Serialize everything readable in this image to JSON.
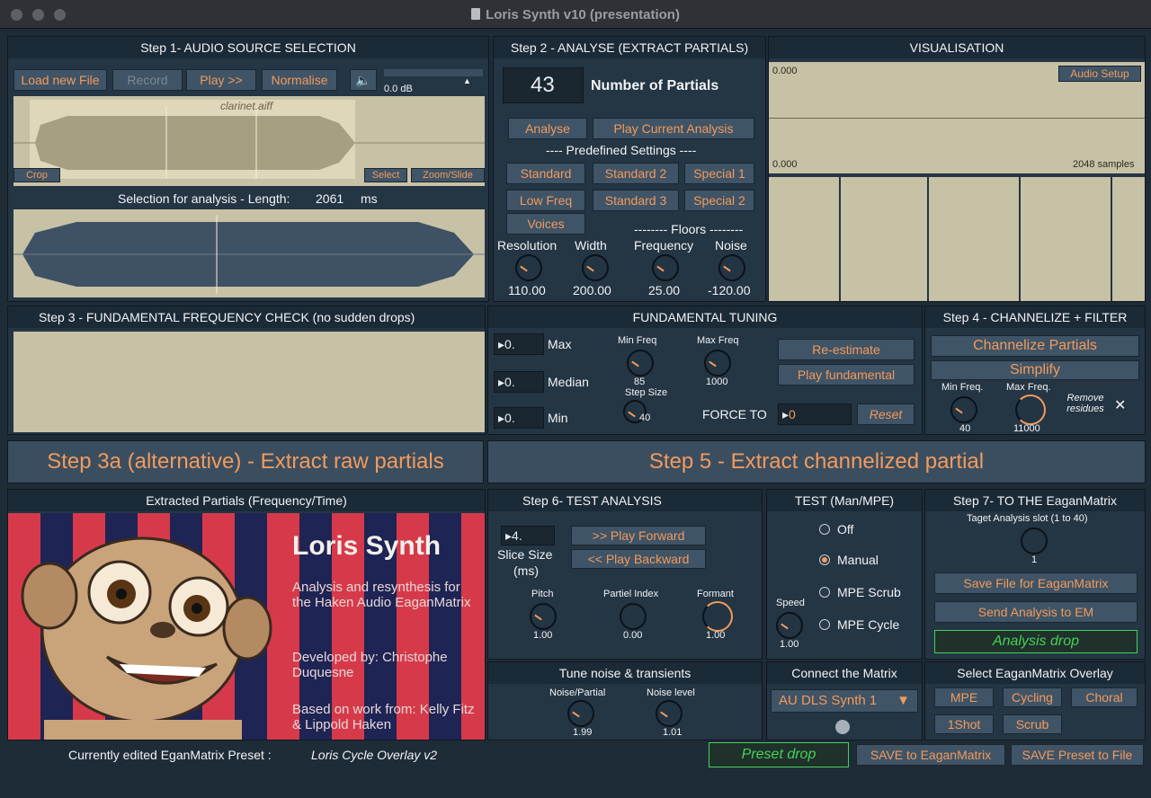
{
  "window": {
    "title": "Loris Synth v10 (presentation)"
  },
  "step1": {
    "header": "Step 1- AUDIO SOURCE SELECTION",
    "buttons": {
      "load": "Load new File",
      "record": "Record",
      "play": "Play >>",
      "normalise": "Normalise"
    },
    "volume_db": "0.0 dB",
    "file_name": "clarinet.aiff",
    "crop": "Crop",
    "select": "Select",
    "zoom_slide": "Zoom/Slide",
    "selection_label": "Selection for analysis - Length:",
    "selection_length": "2061",
    "selection_unit": "ms"
  },
  "step2": {
    "header": "Step 2 - ANALYSE (EXTRACT PARTIALS)",
    "num_partials": "43",
    "num_partials_label": "Number of  Partials",
    "analyse": "Analyse",
    "play_current": "Play Current Analysis",
    "predefined": "---- Predefined Settings ----",
    "presets": [
      "Standard",
      "Standard 2",
      "Special 1",
      "Low Freq",
      "Standard 3",
      "Special 2",
      "Voices"
    ],
    "floors": "-------- Floors --------",
    "knobs": [
      {
        "label": "Resolution",
        "value": "110.00"
      },
      {
        "label": "Width",
        "value": "200.00"
      },
      {
        "label": "Frequency",
        "value": "25.00"
      },
      {
        "label": "Noise",
        "value": "-120.00"
      }
    ]
  },
  "vis": {
    "header": "VISUALISATION",
    "top_value": "0.000",
    "audio_setup": "Audio Setup",
    "bottom_value": "0.000",
    "samples": "2048 samples"
  },
  "step3": {
    "header": "Step 3 - FUNDAMENTAL FREQUENCY CHECK (no sudden drops)"
  },
  "tuning": {
    "header": "FUNDAMENTAL TUNING",
    "rows": [
      {
        "value": "0.",
        "label": "Max"
      },
      {
        "value": "0.",
        "label": "Median"
      },
      {
        "value": "0.",
        "label": "Min"
      }
    ],
    "min_freq_label": "Min Freq",
    "min_freq_value": "85",
    "max_freq_label": "Max Freq",
    "max_freq_value": "1000",
    "step_size_label": "Step Size",
    "step_size_value": "40",
    "reestimate": "Re-estimate",
    "play_fundamental": "Play fundamental",
    "force_label": "FORCE TO",
    "force_value": "0",
    "reset": "Reset"
  },
  "step4": {
    "header": "Step 4 - CHANNELIZE + FILTER",
    "channelize": "Channelize Partials",
    "simplify": "Simplify",
    "min_freq_label": "Min Freq.",
    "min_freq_value": "40",
    "max_freq_label": "Max Freq.",
    "max_freq_value": "11000",
    "remove_residues": "Remove residues"
  },
  "step3a": "Step 3a (alternative) - Extract raw partials",
  "step5": "Step 5 - Extract channelized partial",
  "partials": {
    "header": "Extracted Partials (Frequency/Time)",
    "title": "Loris Synth",
    "desc": "Analysis and resynthesis for the Haken Audio EaganMatrix",
    "dev": "Developed by: Christophe Duquesne",
    "based": "Based on work from: Kelly Fitz & Lippold Haken"
  },
  "step6": {
    "header": "Step 6- TEST ANALYSIS",
    "slice_value": "4.",
    "slice_label": "Slice Size",
    "slice_unit": "(ms)",
    "play_forward": ">> Play Forward",
    "play_backward": "<< Play Backward",
    "knobs": [
      {
        "label": "Pitch",
        "value": "1.00"
      },
      {
        "label": "Partiel Index",
        "value": "0.00"
      },
      {
        "label": "Formant",
        "value": "1.00"
      }
    ]
  },
  "test": {
    "header": "TEST  (Man/MPE)",
    "options": [
      "Off",
      "Manual",
      "MPE Scrub",
      "MPE Cycle"
    ],
    "speed_label": "Speed",
    "speed_value": "1.00"
  },
  "step7": {
    "header": "Step 7- TO THE EaganMatrix",
    "slot_label": "Taget Analysis slot (1 to 40)",
    "slot_value": "1",
    "save_file": "Save File for EaganMatrix",
    "send": "Send Analysis to EM",
    "drop": "Analysis drop"
  },
  "noise": {
    "header": "Tune noise & transients",
    "noise_partial_label": "Noise/Partial",
    "noise_partial_value": "1.99",
    "noise_level_label": "Noise level",
    "noise_level_value": "1.01"
  },
  "connect": {
    "header": "Connect the Matrix",
    "device": "AU DLS Synth 1"
  },
  "overlay": {
    "header": "Select  EaganMatrix Overlay",
    "buttons": [
      "MPE",
      "Cycling",
      "Choral",
      "1Shot",
      "Scrub"
    ]
  },
  "footer": {
    "label": "Currently edited EganMatrix Preset :",
    "preset": "Loris Cycle Overlay v2",
    "preset_drop": "Preset drop",
    "save_em": "SAVE to EaganMatrix",
    "save_file": "SAVE Preset to File"
  },
  "colors": {
    "accent": "#f39a5c",
    "panel": "#243544",
    "display": "#c7c1a5",
    "drop": "#44d25a"
  }
}
